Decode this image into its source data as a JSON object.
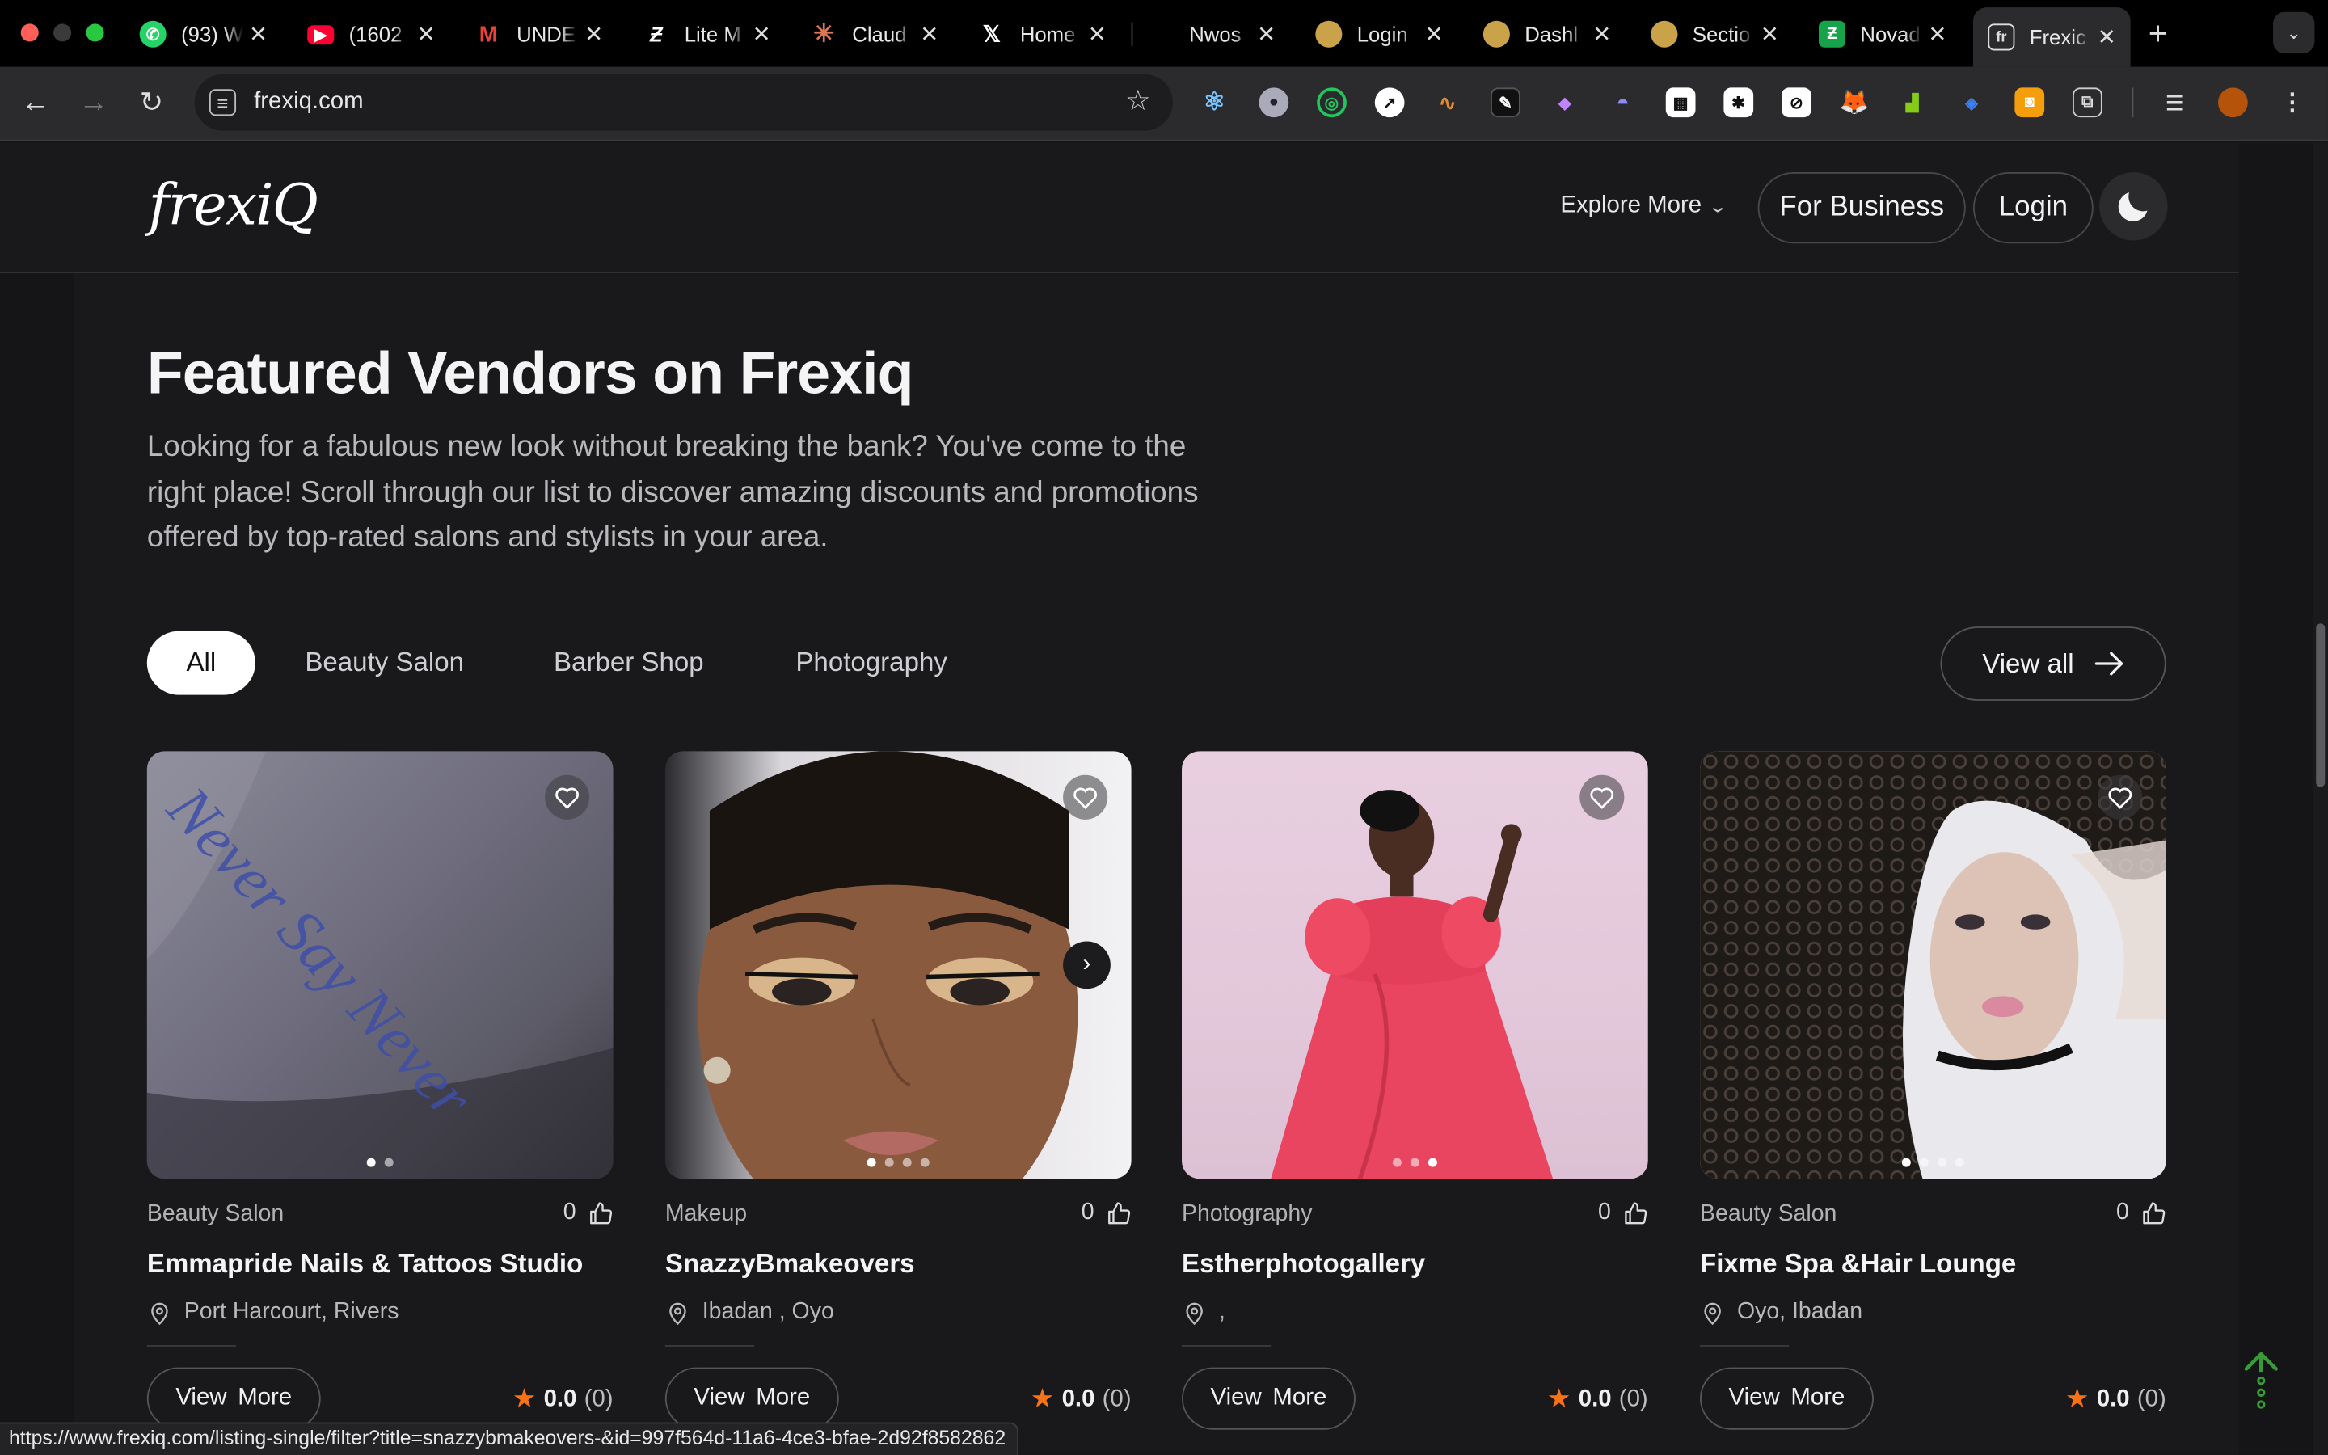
{
  "browser": {
    "tabs": [
      {
        "title": "(93) W",
        "favicon": "whatsapp-icon",
        "color": "#25d366"
      },
      {
        "title": "(1602",
        "favicon": "youtube-icon",
        "color": "#ff0033"
      },
      {
        "title": "UNDE",
        "favicon": "gmail-icon",
        "color": "#ea4335"
      },
      {
        "title": "Lite M",
        "favicon": "lite-icon",
        "color": "#ffffff"
      },
      {
        "title": "Claud",
        "favicon": "claude-icon",
        "color": "#d97757"
      },
      {
        "title": "Home",
        "favicon": "x-icon",
        "color": "#ffffff"
      },
      {
        "title": "Nwos",
        "favicon": "blank-icon",
        "color": "#000000"
      },
      {
        "title": "Login",
        "favicon": "site-icon",
        "color": "#c9a24a"
      },
      {
        "title": "Dashl",
        "favicon": "site-icon",
        "color": "#c9a24a"
      },
      {
        "title": "Sectio",
        "favicon": "site-icon",
        "color": "#c9a24a"
      },
      {
        "title": "Novad",
        "favicon": "novad-icon",
        "color": "#16a34a"
      },
      {
        "title": "Frexic",
        "favicon": "frexiq-icon",
        "color": "#ffffff",
        "active": true
      }
    ],
    "url": "frexiq.com",
    "status_url": "https://www.frexiq.com/listing-single/filter?title=snazzybmakeovers-&id=997f564d-11a6-4ce3-bfae-2d92f8582862"
  },
  "site": {
    "logo": "frexiQ",
    "nav": {
      "explore": "Explore More",
      "business": "For Business",
      "login": "Login"
    }
  },
  "section": {
    "title": "Featured Vendors on Frexiq",
    "description": "Looking for a fabulous new look without breaking the bank? You've come to the right place! Scroll through our list to discover amazing discounts and promotions offered by top-rated salons and stylists in your area.",
    "filters": [
      "All",
      "Beauty Salon",
      "Barber Shop",
      "Photography"
    ],
    "active_filter": "All",
    "view_all": "View all"
  },
  "vendors": [
    {
      "category": "Beauty Salon",
      "likes": "0",
      "name": "Emmapride Nails & Tattoos Studio",
      "location": "Port Harcourt, Rivers",
      "rating": "0.0",
      "reviews": "(0)",
      "more": "View More",
      "image_text": "Never Say Never",
      "image_slides": 2,
      "image_active": 1
    },
    {
      "category": "Makeup",
      "likes": "0",
      "name": "SnazzyBmakeovers",
      "location": "Ibadan , Oyo",
      "rating": "0.0",
      "reviews": "(0)",
      "more": "View More",
      "image_slides": 4,
      "image_active": 1
    },
    {
      "category": "Photography",
      "likes": "0",
      "name": "Estherphotogallery",
      "location": ",",
      "rating": "0.0",
      "reviews": "(0)",
      "more": "View More",
      "image_slides": 3,
      "image_active": 3
    },
    {
      "category": "Beauty Salon",
      "likes": "0",
      "name": "Fixme Spa &Hair Lounge",
      "location": "Oyo, Ibadan",
      "rating": "0.0",
      "reviews": "(0)",
      "more": "View More",
      "image_slides": 4,
      "image_active": 1
    }
  ]
}
